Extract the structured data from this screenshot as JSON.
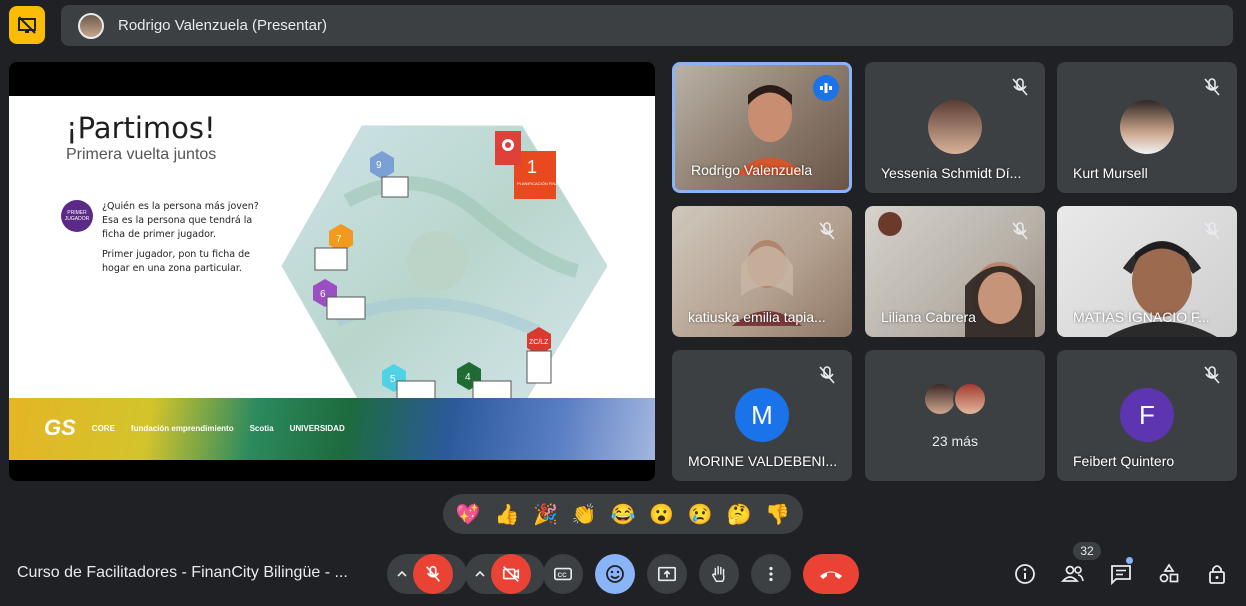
{
  "presenter_bar": {
    "label": "Rodrigo Valenzuela (Presentar)"
  },
  "slide": {
    "title": "¡Partimos!",
    "subtitle": "Primera vuelta juntos",
    "badge_label": "PRIMER JUGADOR",
    "text_1": "¿Quién es la persona más joven? Esa es la persona que tendrá la ficha de primer jugador.",
    "text_2": "Primer jugador, pon tu ficha de hogar en una zona particular.",
    "zone_numbers": [
      "9",
      "7",
      "6",
      "5",
      "4",
      "1",
      "ZC/LZ"
    ],
    "planning_label": "PLANIFICACIÓN FINANCIERA",
    "footer_logos": [
      "GS",
      "CORE",
      "fundación emprendimiento",
      "Scotia",
      "UNIVERSIDAD"
    ]
  },
  "tiles": [
    {
      "name": "Rodrigo Valenzuela",
      "speaking": true
    },
    {
      "name": "Yessenia Schmidt Dí..."
    },
    {
      "name": "Kurt Mursell"
    },
    {
      "name": "katiuska emilia tapia..."
    },
    {
      "name": "Liliana Cabrera"
    },
    {
      "name": "MATIAS IGNACIO F..."
    },
    {
      "name": "MORINE VALDEBENI...",
      "initial": "M",
      "color": "#1a73e8"
    },
    {
      "more": "23 más"
    },
    {
      "name": "Feibert Quintero",
      "initial": "F",
      "color": "#5e35b1"
    }
  ],
  "reactions": [
    "💖",
    "👍",
    "🎉",
    "👏",
    "😂",
    "😮",
    "😢",
    "🤔",
    "👎"
  ],
  "bottom": {
    "meeting_title": "Curso de Facilitadores - FinanCity Bilingüe - ...",
    "participant_count": "32"
  },
  "colors": {
    "danger": "#ea4335",
    "accent": "#8ab4f8",
    "surface": "#3c4043",
    "background": "#202124"
  }
}
